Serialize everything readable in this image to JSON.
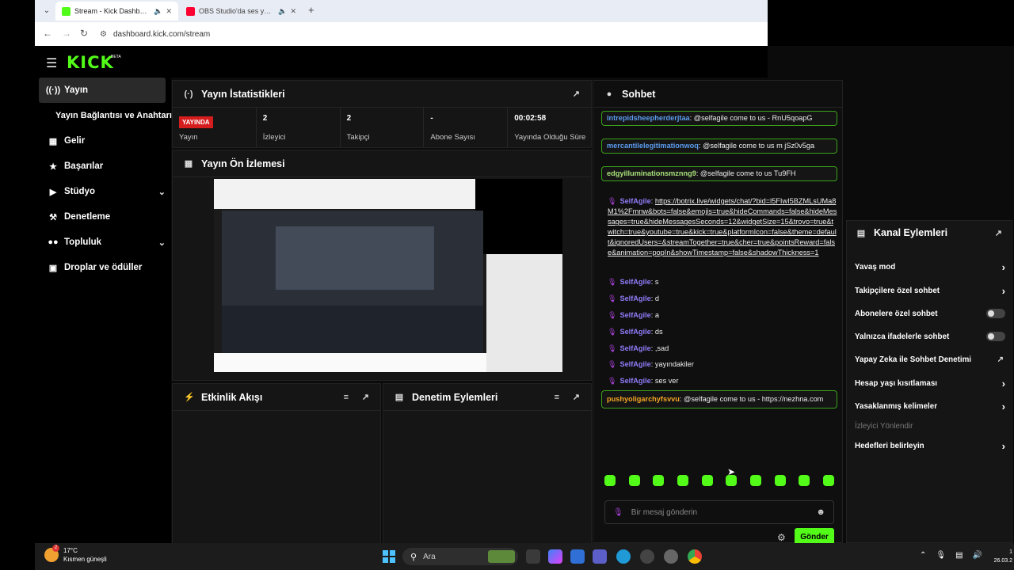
{
  "browser": {
    "tabs": [
      {
        "title": "Stream - Kick Dashboard"
      },
      {
        "title": "OBS Studio'da ses yankısını"
      }
    ],
    "url": "dashboard.kick.com/stream"
  },
  "app": {
    "logo": "KICK",
    "logo_badge": "BETA"
  },
  "sidebar": {
    "items": [
      {
        "label": "Yayın",
        "icon": "broadcast-icon"
      },
      {
        "label": "Yayın Bağlantısı ve Anahtarı"
      },
      {
        "label": "Gelir",
        "icon": "wallet-icon"
      },
      {
        "label": "Başarılar",
        "icon": "trophy-icon"
      },
      {
        "label": "Stüdyo",
        "icon": "video-icon"
      },
      {
        "label": "Denetleme",
        "icon": "wrench-icon"
      },
      {
        "label": "Topluluk",
        "icon": "people-icon"
      },
      {
        "label": "Droplar ve ödüller",
        "icon": "gift-icon"
      }
    ]
  },
  "stats": {
    "title": "Yayın İstatistikleri",
    "items": [
      {
        "value": "YAYINDA",
        "label": "Yayın"
      },
      {
        "value": "2",
        "label": "İzleyici"
      },
      {
        "value": "2",
        "label": "Takipçi"
      },
      {
        "value": "-",
        "label": "Abone Sayısı"
      },
      {
        "value": "00:02:58",
        "label": "Yayında Olduğu Süre"
      }
    ]
  },
  "preview": {
    "title": "Yayın Ön İzlemesi"
  },
  "activity": {
    "title": "Etkinlik Akışı"
  },
  "moderation": {
    "title": "Denetim Eylemleri"
  },
  "chat": {
    "title": "Sohbet",
    "messages": [
      {
        "user": "intrepidsheepherderjtaa",
        "text": ": @selfagile come to us - RnU5qoapG"
      },
      {
        "user": "mercantilelegitimationwoq",
        "text": ": @selfagile come to us m jSz0v5ga"
      },
      {
        "user": "edgyilluminationsmznng9",
        "text": ": @selfagile come to us Tu9FH"
      },
      {
        "user": "SelfAgile",
        "text": "https://botrix.live/widgets/chat/?bid=l5FIwI5BZMLsUMa8M1%2Fmnw&bots=false&emojis=true&hideCommands=false&hideMessages=true&hideMessagesSeconds=12&widgetSize=15&trovo=true&twitch=true&youtube=true&kick=true&platformIcon=false&theme=default&ignoredUsers=&streamTogether=true&cher=true&pointsReward=false&animation=popIn&showTimestamp=false&shadowThickness=1"
      },
      {
        "user": "SelfAgile",
        "text": "s"
      },
      {
        "user": "SelfAgile",
        "text": "d"
      },
      {
        "user": "SelfAgile",
        "text": "a"
      },
      {
        "user": "SelfAgile",
        "text": "ds"
      },
      {
        "user": "SelfAgile",
        "text": ",sad"
      },
      {
        "user": "SelfAgile",
        "text": "yayındakiler"
      },
      {
        "user": "SelfAgile",
        "text": "ses ver"
      },
      {
        "user": "pushyoligarchyfsvvu",
        "text": ": @selfagile come to us - https://nezhna.com"
      }
    ],
    "input_placeholder": "Bir mesaj gönderin",
    "send_label": "Gönder"
  },
  "channel_actions": {
    "title": "Kanal Eylemleri",
    "items": [
      {
        "label": "Yavaş mod",
        "kind": "chevron"
      },
      {
        "label": "Takipçilere özel sohbet",
        "kind": "chevron"
      },
      {
        "label": "Abonelere özel sohbet",
        "kind": "toggle",
        "on": false
      },
      {
        "label": "Yalnızca ifadelerle sohbet",
        "kind": "toggle",
        "on": false
      },
      {
        "label": "Yapay Zeka ile Sohbet Denetimi",
        "kind": "external"
      },
      {
        "label": "Hesap yaşı kısıtlaması",
        "kind": "chevron"
      },
      {
        "label": "Yasaklanmış kelimeler",
        "kind": "chevron"
      },
      {
        "label": "İzleyici Yönlendir",
        "kind": "disabled"
      },
      {
        "label": "Hedefleri belirleyin",
        "kind": "chevron"
      }
    ]
  },
  "taskbar": {
    "weather_temp": "17°C",
    "weather_desc": "Kısmen güneşli",
    "weather_badge": "2",
    "search_label": "Ara",
    "clock_time": "1",
    "clock_date": "26.03.2"
  },
  "colors": {
    "accent": "#53fc18",
    "live": "#d61d1d"
  }
}
